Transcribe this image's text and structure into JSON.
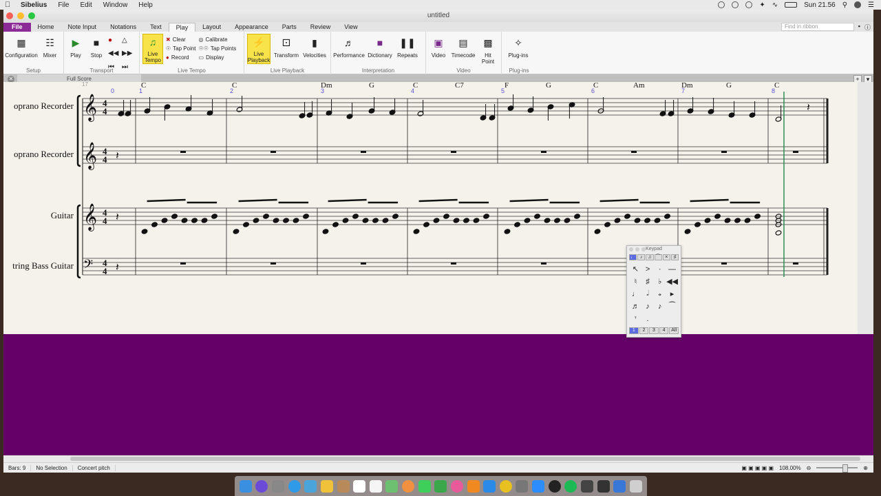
{
  "menubar": {
    "app": "Sibelius",
    "items": [
      "File",
      "Edit",
      "Window",
      "Help"
    ],
    "clock": "Sun 21.56"
  },
  "window": {
    "title": "untitled"
  },
  "ribbon_tabs": {
    "file": "File",
    "tabs": [
      "Home",
      "Note Input",
      "Notations",
      "Text",
      "Play",
      "Layout",
      "Appearance",
      "Parts",
      "Review",
      "View"
    ],
    "active": "Play",
    "find_placeholder": "Find in ribbon"
  },
  "ribbon": {
    "setup": {
      "title": "Setup",
      "configuration": "Configuration",
      "mixer": "Mixer"
    },
    "transport": {
      "title": "Transport",
      "play": "Play",
      "stop": "Stop"
    },
    "live_tempo": {
      "title": "Live Tempo",
      "live_tempo_btn": "Live\nTempo",
      "clear": "Clear",
      "tap_point": "Tap Point",
      "record": "Record",
      "calibrate": "Calibrate",
      "tap_points": "Tap Points",
      "display": "Display"
    },
    "live_playback": {
      "title": "Live Playback",
      "live_playback_btn": "Live\nPlayback",
      "transform": "Transform",
      "velocities": "Velocities"
    },
    "interpretation": {
      "title": "Interpretation",
      "performance": "Performance",
      "dictionary": "Dictionary",
      "repeats": "Repeats"
    },
    "video": {
      "title": "Video",
      "video": "Video",
      "timecode": "Timecode",
      "hit_point": "Hit\nPoint"
    },
    "plugins": {
      "title": "Plug-ins",
      "plugins": "Plug-ins"
    }
  },
  "score_tab": {
    "name": "Full Score"
  },
  "score": {
    "bar_numbers": [
      "0",
      "1",
      "2",
      "3",
      "4",
      "5",
      "6",
      "7",
      "8"
    ],
    "top_number": "17",
    "chords": [
      "C",
      "C",
      "Dm",
      "G",
      "C",
      "C7",
      "F",
      "G",
      "C",
      "Am",
      "Dm",
      "G",
      "C"
    ],
    "staves": [
      "oprano Recorder",
      "oprano Recorder",
      "Guitar",
      "tring Bass Guitar"
    ],
    "time_signature": "4/4"
  },
  "keypad": {
    "title": "Keypad",
    "layouts": [
      "1",
      "2",
      "3",
      "4",
      "All"
    ],
    "active_layout": "1"
  },
  "statusbar": {
    "bars": "Bars: 9",
    "selection": "No Selection",
    "pitch": "Concert pitch",
    "zoom": "108.00%"
  },
  "colors": {
    "file_tab": "#8c2a97",
    "highlight_button": "#f8e34a",
    "background_purple": "#640068",
    "bar_number": "#5b4fd0",
    "playback_line": "#2e8b57"
  }
}
